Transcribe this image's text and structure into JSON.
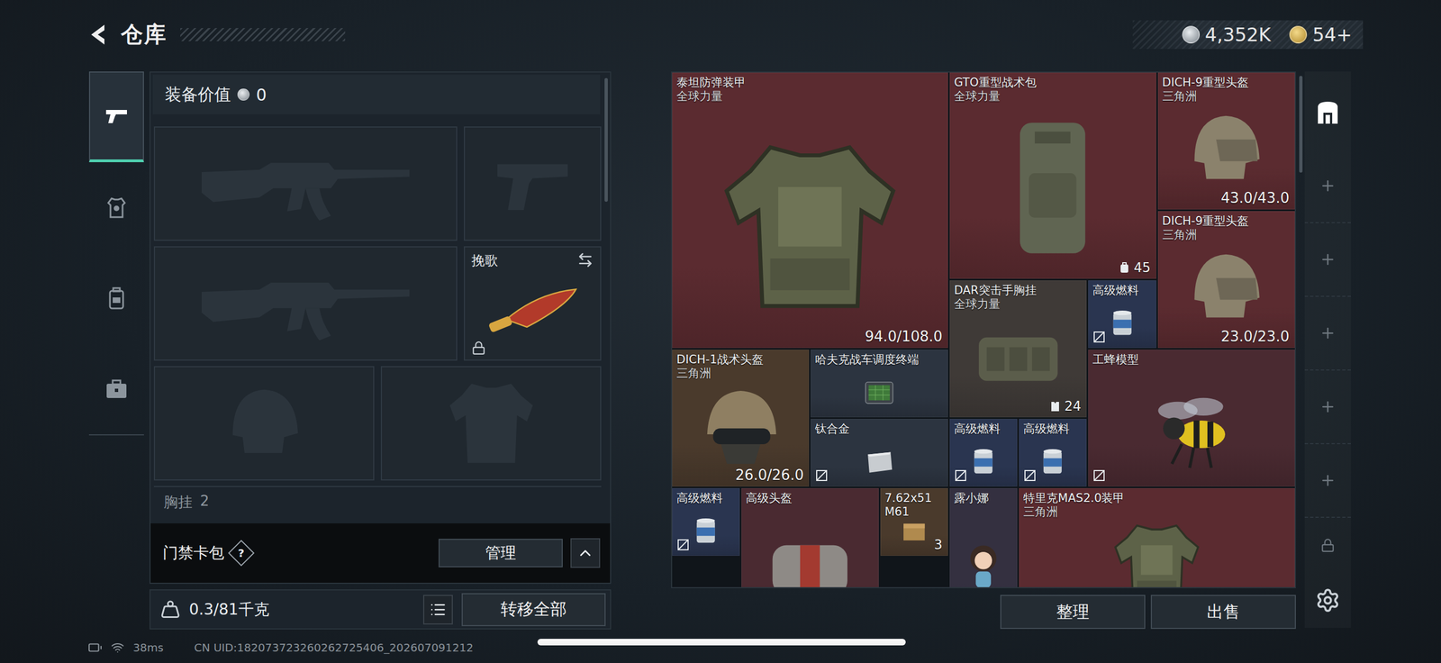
{
  "topBar": {
    "title": "仓库",
    "currencies": [
      {
        "kind": "silver",
        "amount": "4,352K"
      },
      {
        "kind": "gold",
        "amount": "54+"
      }
    ]
  },
  "sideTabs": [
    {
      "kind": "weapons",
      "selected": true
    },
    {
      "kind": "equipment",
      "selected": false
    },
    {
      "kind": "backpack",
      "selected": false
    },
    {
      "kind": "cases",
      "selected": false
    }
  ],
  "loadout": {
    "valueLabel": "装备价值",
    "value": "0",
    "weaponSlots": [
      {
        "kind": "rifle",
        "label": "",
        "locked": false
      },
      {
        "kind": "pistol",
        "label": "",
        "locked": false
      },
      {
        "kind": "rifle",
        "label": "",
        "locked": false
      },
      {
        "kind": "melee",
        "label": "挽歌",
        "locked": true
      }
    ],
    "gearSlots": [
      {
        "kind": "helmet"
      },
      {
        "kind": "armor"
      }
    ],
    "chestRig": {
      "label": "胸挂",
      "value": "2"
    },
    "cardPack": {
      "label": "门禁卡包",
      "help": "?",
      "button": "管理",
      "expanded": false
    },
    "weight": "0.3/81千克",
    "transferButton": "转移全部"
  },
  "items": [
    {
      "name": "泰坦防弹装甲",
      "faction": "全球力量",
      "kind": "armor",
      "color": "#5b2b30",
      "durability": "94.0/108.0",
      "count": "",
      "noSell": false
    },
    {
      "name": "GTO重型战术包",
      "faction": "全球力量",
      "kind": "backpack",
      "color": "#5b2b30",
      "durability": "",
      "count": "45",
      "noSell": false
    },
    {
      "name": "DICH-9重型头盔",
      "faction": "三角洲",
      "kind": "helmet",
      "color": "#5b2b30",
      "durability": "43.0/43.0",
      "count": "",
      "noSell": false
    },
    {
      "name": "DICH-9重型头盔",
      "faction": "三角洲",
      "kind": "helmet",
      "color": "#5b2b30",
      "durability": "23.0/23.0",
      "count": "",
      "noSell": false
    },
    {
      "name": "DAR突击手胸挂",
      "faction": "全球力量",
      "kind": "rig",
      "color": "#3f3a37",
      "durability": "",
      "count": "24",
      "noSell": false
    },
    {
      "name": "高级燃料",
      "faction": "",
      "kind": "fuel",
      "color": "#2a3550",
      "durability": "",
      "count": "",
      "noSell": true
    },
    {
      "name": "DICH-1战术头盔",
      "faction": "三角洲",
      "kind": "tacticalHelmet",
      "color": "#4a3a2c",
      "durability": "26.0/26.0",
      "count": "",
      "noSell": false
    },
    {
      "name": "哈夫克战车调度终端",
      "faction": "",
      "kind": "terminal",
      "color": "#2c3440",
      "durability": "",
      "count": "",
      "noSell": false
    },
    {
      "name": "钛合金",
      "faction": "",
      "kind": "ingot",
      "color": "#2c3440",
      "durability": "",
      "count": "",
      "noSell": true
    },
    {
      "name": "高级燃料",
      "faction": "",
      "kind": "fuel",
      "color": "#2a3550",
      "durability": "",
      "count": "",
      "noSell": true
    },
    {
      "name": "高级燃料",
      "faction": "",
      "kind": "fuel",
      "color": "#2a3550",
      "durability": "",
      "count": "",
      "noSell": true
    },
    {
      "name": "工蜂模型",
      "faction": "",
      "kind": "bee",
      "color": "#4a2a31",
      "durability": "",
      "count": "",
      "noSell": true
    },
    {
      "name": "高级燃料",
      "faction": "",
      "kind": "fuel",
      "color": "#2a3550",
      "durability": "",
      "count": "",
      "noSell": true
    },
    {
      "name": "高级头盔",
      "faction": "",
      "kind": "bag",
      "color": "#4a2a31",
      "durability": "",
      "count": "",
      "noSell": false
    },
    {
      "name": "7.62x51 M61",
      "faction": "",
      "kind": "ammo",
      "color": "#4a3a2c",
      "durability": "",
      "count": "3",
      "noSell": false
    },
    {
      "name": "露小娜",
      "faction": "",
      "kind": "figure",
      "color": "#343040",
      "durability": "",
      "count": "",
      "noSell": false
    },
    {
      "name": "特里克MAS2.0装甲",
      "faction": "三角洲",
      "kind": "armor",
      "color": "#5b2b30",
      "durability": "",
      "count": "",
      "noSell": false
    }
  ],
  "actions": [
    "整理",
    "出售"
  ],
  "warehouseTabs": [
    {
      "kind": "warehouse",
      "selected": true
    },
    {
      "kind": "add",
      "selected": false
    },
    {
      "kind": "add",
      "selected": false
    },
    {
      "kind": "add",
      "selected": false
    },
    {
      "kind": "add",
      "selected": false
    },
    {
      "kind": "add",
      "selected": false
    },
    {
      "kind": "locked",
      "selected": false
    }
  ],
  "status": {
    "ping": "38ms",
    "uid": "CN UID:182073723260262725406_202607091212"
  }
}
